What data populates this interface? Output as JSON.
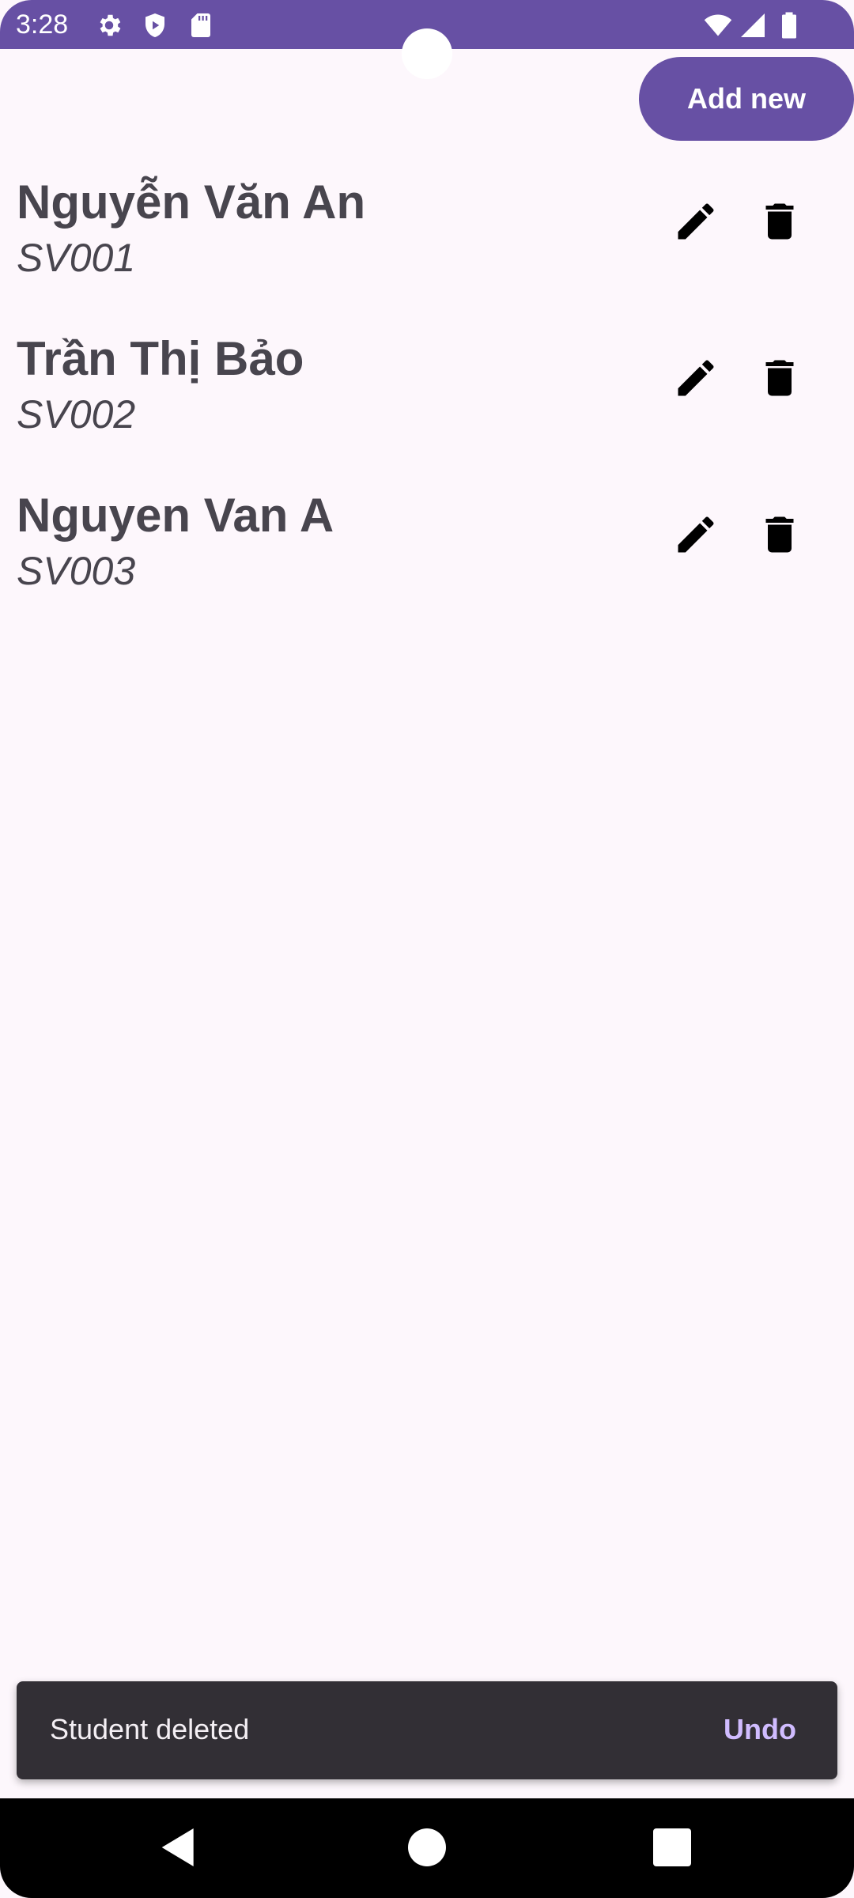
{
  "status_bar": {
    "time": "3:28",
    "icons": [
      "gear-icon",
      "shield-icon",
      "sd-card-icon",
      "wifi-icon",
      "signal-icon",
      "battery-icon"
    ],
    "color": "#6750A4"
  },
  "toolbar": {
    "add_label": "Add new"
  },
  "students": [
    {
      "name": "Nguyễn Văn An",
      "id": "SV001"
    },
    {
      "name": "Trần Thị Bảo",
      "id": "SV002"
    },
    {
      "name": "Nguyen Van A",
      "id": "SV003"
    }
  ],
  "row_icons": [
    "edit-icon",
    "delete-icon"
  ],
  "snackbar": {
    "message": "Student deleted",
    "action": "Undo"
  },
  "nav_bar": {
    "buttons": [
      "back-icon",
      "home-icon",
      "recents-icon"
    ]
  },
  "colors": {
    "primary": "#6750A4",
    "background": "#FDF7FC",
    "text": "#48454E",
    "snackbar": "#322F35",
    "snackbar_action": "#D0BCFF"
  }
}
